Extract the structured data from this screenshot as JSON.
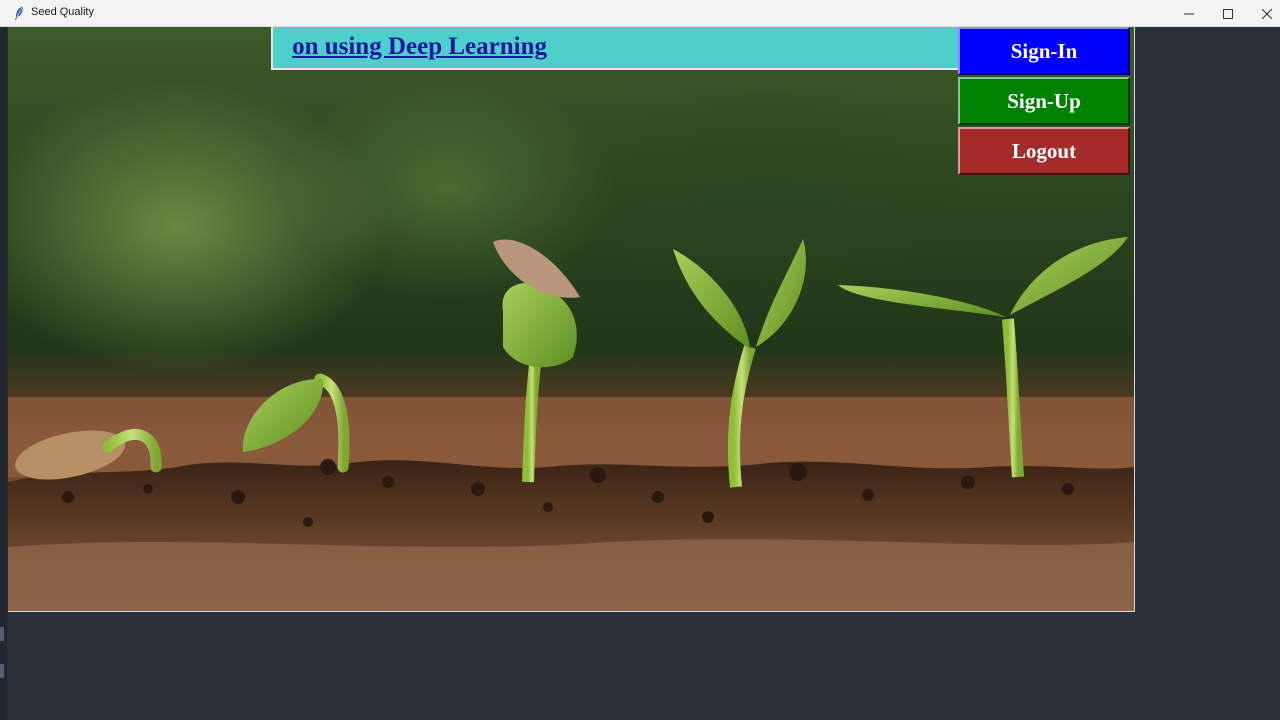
{
  "window": {
    "title": "Seed Quality",
    "app_icon": "feather-icon",
    "controls": {
      "minimize_icon": "minimize-icon",
      "maximize_icon": "maximize-icon",
      "close_icon": "close-icon"
    }
  },
  "banner": {
    "text": "on using Deep Learning",
    "background": "#4ecfcc",
    "text_color": "#1a1a9a"
  },
  "buttons": {
    "signin": {
      "label": "Sign-In",
      "color": "#0000ff"
    },
    "signup": {
      "label": "Sign-Up",
      "color": "#008000"
    },
    "logout": {
      "label": "Logout",
      "color": "#a52a2a"
    }
  }
}
